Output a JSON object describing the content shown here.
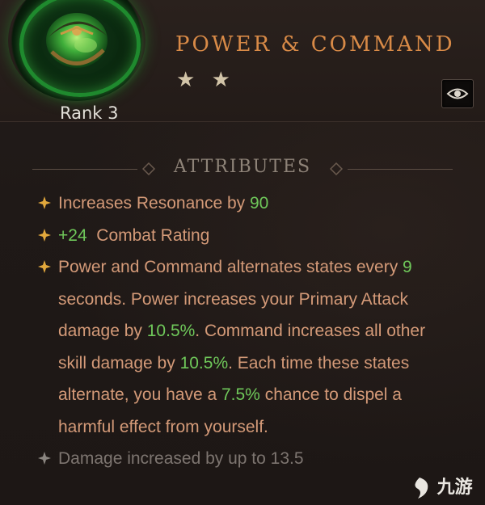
{
  "item": {
    "name": "POWER & COMMAND",
    "rank_label": "Rank 3",
    "stars": "★ ★",
    "star_count": 2,
    "icon": "emerald-helm-gem-icon"
  },
  "actions": {
    "inspect_icon": "eye-icon"
  },
  "section": {
    "title": "ATTRIBUTES"
  },
  "attributes": [
    {
      "pre": "Increases Resonance by ",
      "num": "90",
      "post": ""
    },
    {
      "pre": "",
      "num": "+24",
      "post": "  Combat Rating"
    },
    {
      "text_parts": [
        "Power and Command alternates states every ",
        "9",
        " seconds. Power increases your Primary Attack damage by ",
        "10.5%",
        ". Command increases all other skill damage by ",
        "10.5%",
        ". Each time these states alternate, you have a ",
        "7.5%",
        " chance to dispel a harmful effect from yourself."
      ]
    },
    {
      "dim_text": "Damage increased by up to 13.5"
    }
  ],
  "colors": {
    "title": "#d88a47",
    "body_text": "#d49a78",
    "value_green": "#6fc85a",
    "gem_glow": "#1f8a2e"
  },
  "watermark": {
    "text": "九游"
  }
}
